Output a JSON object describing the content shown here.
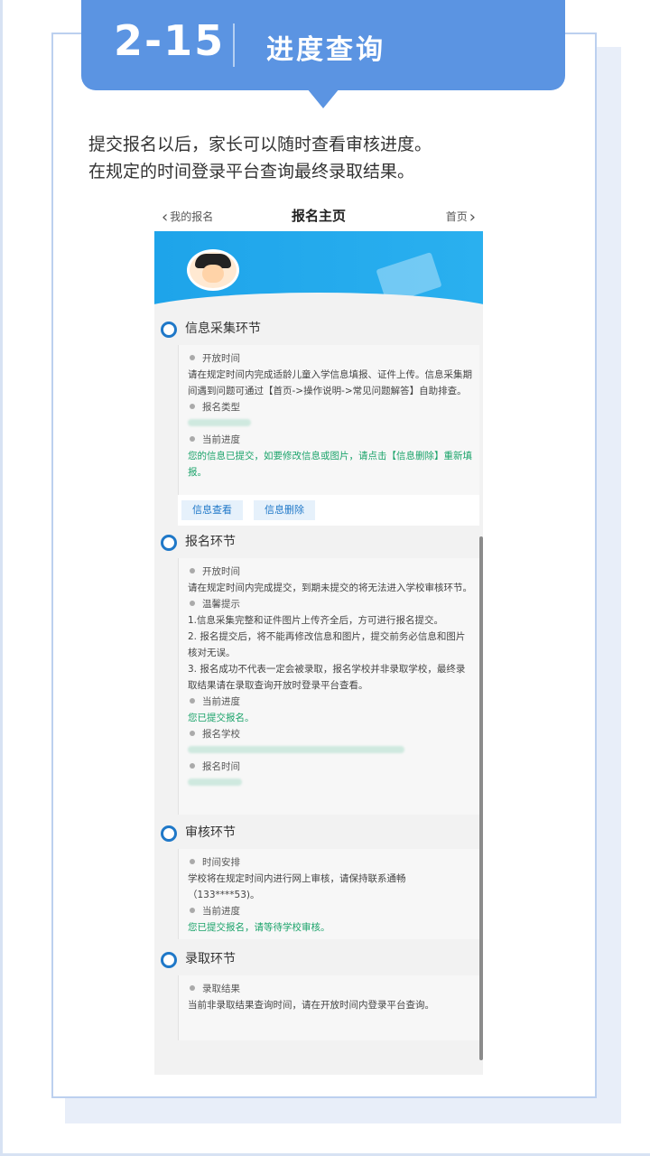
{
  "header": {
    "number": "2-15",
    "title": "进度查询"
  },
  "intro": [
    "提交报名以后，家长可以随时查看审核进度。",
    "在规定的时间登录平台查询最终录取结果。"
  ],
  "topbar": {
    "back": "我的报名",
    "title": "报名主页",
    "home": "首页"
  },
  "colors": {
    "accent": "#5b94e2",
    "ring": "#1f78c8",
    "status_green": "#1aa36a"
  },
  "sections": [
    {
      "title": "信息采集环节",
      "items": [
        {
          "label": "开放时间",
          "text": "请在规定时间内完成适龄儿童入学信息填报、证件上传。信息采集期间遇到问题可通过【首页->操作说明->常见问题解答】自助排查。"
        },
        {
          "label": "报名类型",
          "text": ""
        },
        {
          "label": "当前进度",
          "text": "您的信息已提交，如要修改信息或图片，请点击【信息删除】重新填报。"
        }
      ],
      "buttons": [
        "信息查看",
        "信息删除"
      ]
    },
    {
      "title": "报名环节",
      "items": [
        {
          "label": "开放时间",
          "text": "请在规定时间内完成提交，到期未提交的将无法进入学校审核环节。"
        },
        {
          "label": "温馨提示",
          "lines": [
            "1.信息采集完整和证件图片上传齐全后，方可进行报名提交。",
            "2. 报名提交后，将不能再修改信息和图片，提交前务必信息和图片核对无误。",
            "3. 报名成功不代表一定会被录取，报名学校并非录取学校，最终录取结果请在录取查询开放时登录平台查看。"
          ]
        },
        {
          "label": "当前进度",
          "text": "您已提交报名。"
        },
        {
          "label": "报名学校",
          "text": ""
        },
        {
          "label": "报名时间",
          "text": ""
        }
      ]
    },
    {
      "title": "审核环节",
      "items": [
        {
          "label": "时间安排",
          "text": "学校将在规定时间内进行网上审核，请保持联系通畅（133****53)。"
        },
        {
          "label": "当前进度",
          "text": "您已提交报名，请等待学校审核。"
        }
      ]
    },
    {
      "title": "录取环节",
      "items": [
        {
          "label": "录取结果",
          "text": "当前非录取结果查询时间，请在开放时间内登录平台查询。"
        }
      ]
    }
  ]
}
